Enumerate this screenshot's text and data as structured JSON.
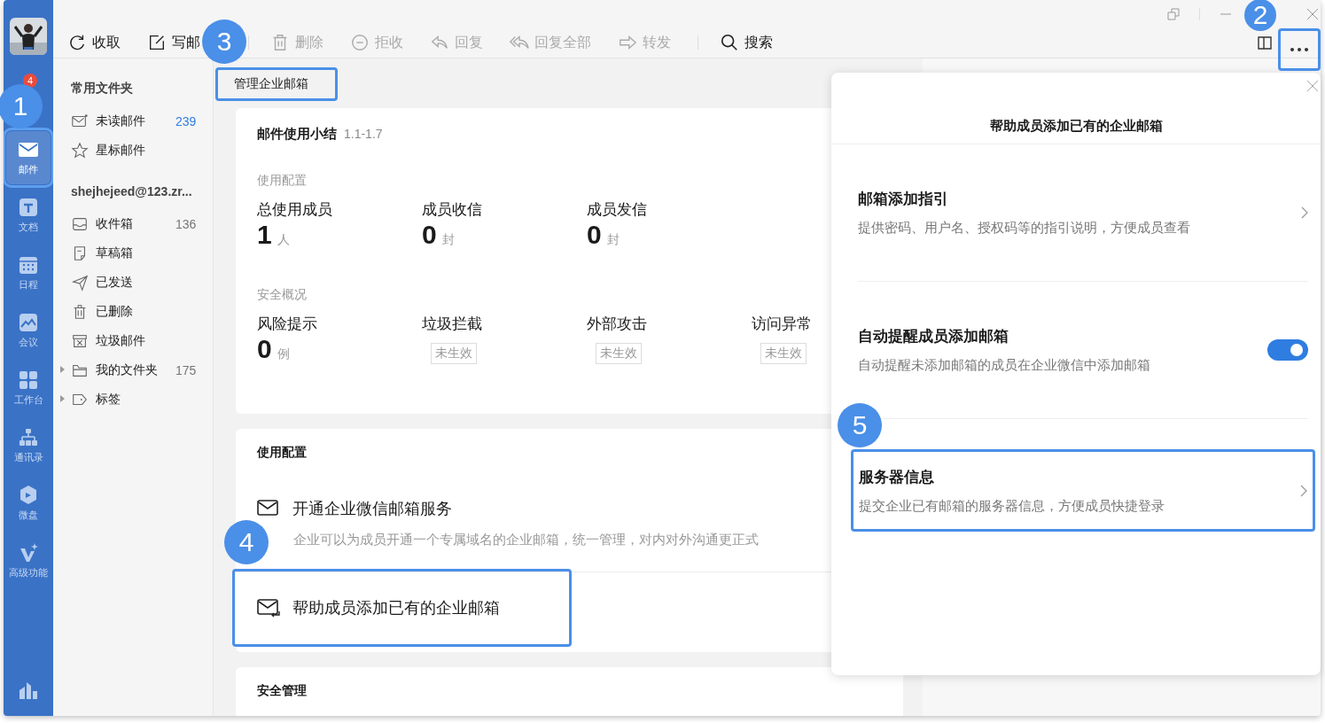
{
  "nav": {
    "badge": "4",
    "items": [
      {
        "label": "邮件",
        "selected": true,
        "highlighted": true
      },
      {
        "label": "文档",
        "selected": false,
        "highlighted": false
      },
      {
        "label": "日程",
        "selected": false,
        "highlighted": false
      },
      {
        "label": "会议",
        "selected": false,
        "highlighted": false
      },
      {
        "label": "工作台",
        "selected": false,
        "highlighted": false
      },
      {
        "label": "通讯录",
        "selected": false,
        "highlighted": false
      },
      {
        "label": "微盘",
        "selected": false,
        "highlighted": false
      },
      {
        "label": "高级功能",
        "selected": false,
        "highlighted": false
      }
    ]
  },
  "toolbar": {
    "buttons": [
      {
        "label": "收取",
        "disabled": false
      },
      {
        "label": "写邮",
        "disabled": false
      },
      {
        "label": "删除",
        "disabled": true
      },
      {
        "label": "拒收",
        "disabled": true
      },
      {
        "label": "回复",
        "disabled": true
      },
      {
        "label": "回复全部",
        "disabled": true
      },
      {
        "label": "转发",
        "disabled": true
      },
      {
        "label": "搜索",
        "disabled": false
      }
    ],
    "more_button": {
      "highlighted": true
    }
  },
  "folders": {
    "sections": [
      {
        "title": "常用文件夹",
        "items": [
          {
            "label": "未读邮件",
            "count": "239",
            "color": "#2f7de1"
          },
          {
            "label": "星标邮件"
          }
        ]
      },
      {
        "title": "shejhejeed@123.zr...",
        "items": [
          {
            "label": "收件箱",
            "count": "136",
            "color": "#777777"
          },
          {
            "label": "草稿箱"
          },
          {
            "label": "已发送"
          },
          {
            "label": "已删除"
          },
          {
            "label": "垃圾邮件"
          },
          {
            "label": "我的文件夹",
            "count": "175",
            "color": "#777777",
            "expanded": false
          },
          {
            "label": "标签",
            "expanded": false
          }
        ]
      }
    ]
  },
  "tabs": [
    {
      "label": "管理企业邮箱",
      "highlighted": true
    }
  ],
  "summary": {
    "title": "邮件使用小结",
    "range": "1.1-1.7",
    "sections": [
      {
        "title": "使用配置",
        "stats": [
          {
            "kind": "number",
            "label": "总使用成员",
            "value": "1",
            "unit": "人"
          },
          {
            "kind": "number",
            "label": "成员收信",
            "value": "0",
            "unit": "封"
          },
          {
            "kind": "number",
            "label": "成员发信",
            "value": "0",
            "unit": "封"
          }
        ]
      },
      {
        "title": "安全概况",
        "stats": [
          {
            "kind": "number",
            "label": "风险提示",
            "value": "0",
            "unit": "例"
          },
          {
            "kind": "badge",
            "label": "垃圾拦截",
            "badge": "未生效"
          },
          {
            "kind": "badge",
            "label": "外部攻击",
            "badge": "未生效"
          },
          {
            "kind": "badge",
            "label": "访问异常",
            "badge": "未生效"
          }
        ]
      }
    ]
  },
  "config": {
    "title": "使用配置",
    "items": [
      {
        "title": "开通企业微信邮箱服务",
        "description": "企业可以为成员开通一个专属域名的企业邮箱，统一管理，对内对外沟通更正式",
        "highlighted": false
      },
      {
        "title": "帮助成员添加已有的企业邮箱",
        "highlighted": true
      }
    ]
  },
  "security": {
    "title": "安全管理"
  },
  "panel": {
    "title": "帮助成员添加已有的企业邮箱",
    "items": [
      {
        "kind": "link",
        "title": "邮箱添加指引",
        "description": "提供密码、用户名、授权码等的指引说明，方便成员查看",
        "highlighted": false
      },
      {
        "kind": "toggle",
        "title": "自动提醒成员添加邮箱",
        "description": "自动提醒未添加邮箱的成员在企业微信中添加邮箱",
        "on": true,
        "highlighted": false
      },
      {
        "kind": "link",
        "title": "服务器信息",
        "description": "提交企业已有邮箱的服务器信息，方便成员快捷登录",
        "highlighted": true
      }
    ]
  },
  "callouts": [
    {
      "number": "1"
    },
    {
      "number": "2"
    },
    {
      "number": "3"
    },
    {
      "number": "4"
    },
    {
      "number": "5"
    }
  ]
}
